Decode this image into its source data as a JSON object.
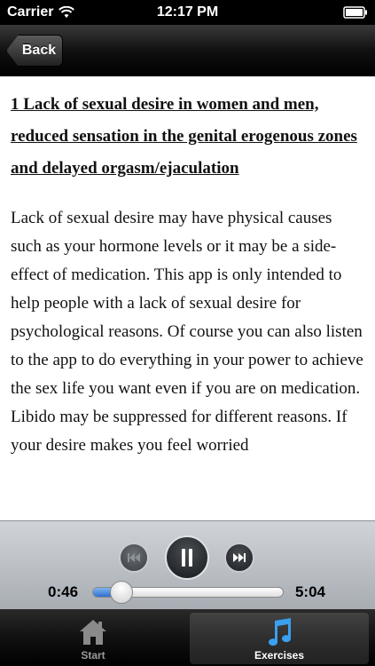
{
  "status_bar": {
    "carrier": "Carrier",
    "time": "12:17 PM",
    "icons": [
      "wifi-icon",
      "battery-icon"
    ]
  },
  "nav": {
    "back_label": "Back"
  },
  "content": {
    "heading": "1 Lack of sexual desire in women and men, reduced sensation in the genital erogenous zones and delayed orgasm/ejaculation",
    "paragraph1": "Lack of sexual desire may have physical causes such as your hormone levels or it may be a side-effect of medication. This app is only intended to help people with a lack of sexual desire for psychological reasons. Of course you can also listen to the app to do everything in your power to achieve the sex life you want even if you are on medication.",
    "paragraph2": "Libido may be suppressed for different reasons. If your desire makes you feel worried"
  },
  "player": {
    "current_time": "0:46",
    "total_time": "5:04",
    "progress": 0.151,
    "icons": [
      "previous-icon",
      "pause-icon",
      "next-icon"
    ]
  },
  "tabs": [
    {
      "label": "Start",
      "icon": "home-icon",
      "selected": false
    },
    {
      "label": "Exercises",
      "icon": "music-note-icon",
      "selected": true
    }
  ],
  "colors": {
    "selected_tab_icon": "#3aa0f0",
    "progress_fill": "#2f6fd1"
  }
}
